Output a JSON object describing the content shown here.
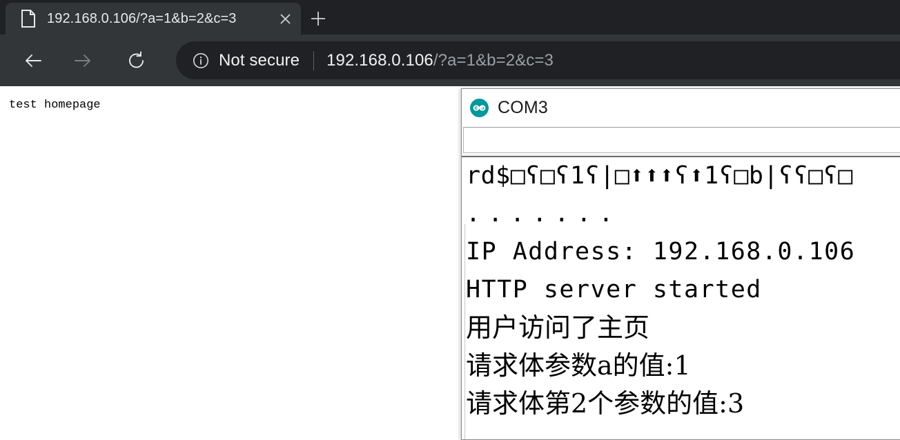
{
  "browser": {
    "tab": {
      "favicon": "document-icon",
      "title": "192.168.0.106/?a=1&b=2&c=3",
      "close_label": "×"
    },
    "newtab_label": "+",
    "nav": {
      "back": "←",
      "forward": "→",
      "reload": "↻"
    },
    "omnibox": {
      "security_icon": "info-circle-icon",
      "security_label": "Not secure",
      "url_host": "192.168.0.106",
      "url_path": "/?a=1&b=2&c=3"
    }
  },
  "page": {
    "body_text": "test homepage"
  },
  "serial_monitor": {
    "logo": "arduino-infinity-icon",
    "title": "COM3",
    "input_value": "",
    "input_placeholder": "",
    "console_lines": [
      {
        "text": "rd$□ʕ□ʕ1ʕ|□⬆⬆⬆ʕ⬆1ʕ□b|ʕʕ□ʕ□",
        "style": "garbled"
      },
      {
        "text": ".......",
        "style": "dots"
      },
      {
        "text": "IP Address: 192.168.0.106",
        "style": "mono"
      },
      {
        "text": "HTTP server started",
        "style": "mono"
      },
      {
        "text": "用户访问了主页",
        "style": "cjk"
      },
      {
        "text": "请求体参数a的值:1",
        "style": "cjk"
      },
      {
        "text": "请求体第2个参数的值:3",
        "style": "cjk"
      }
    ]
  }
}
